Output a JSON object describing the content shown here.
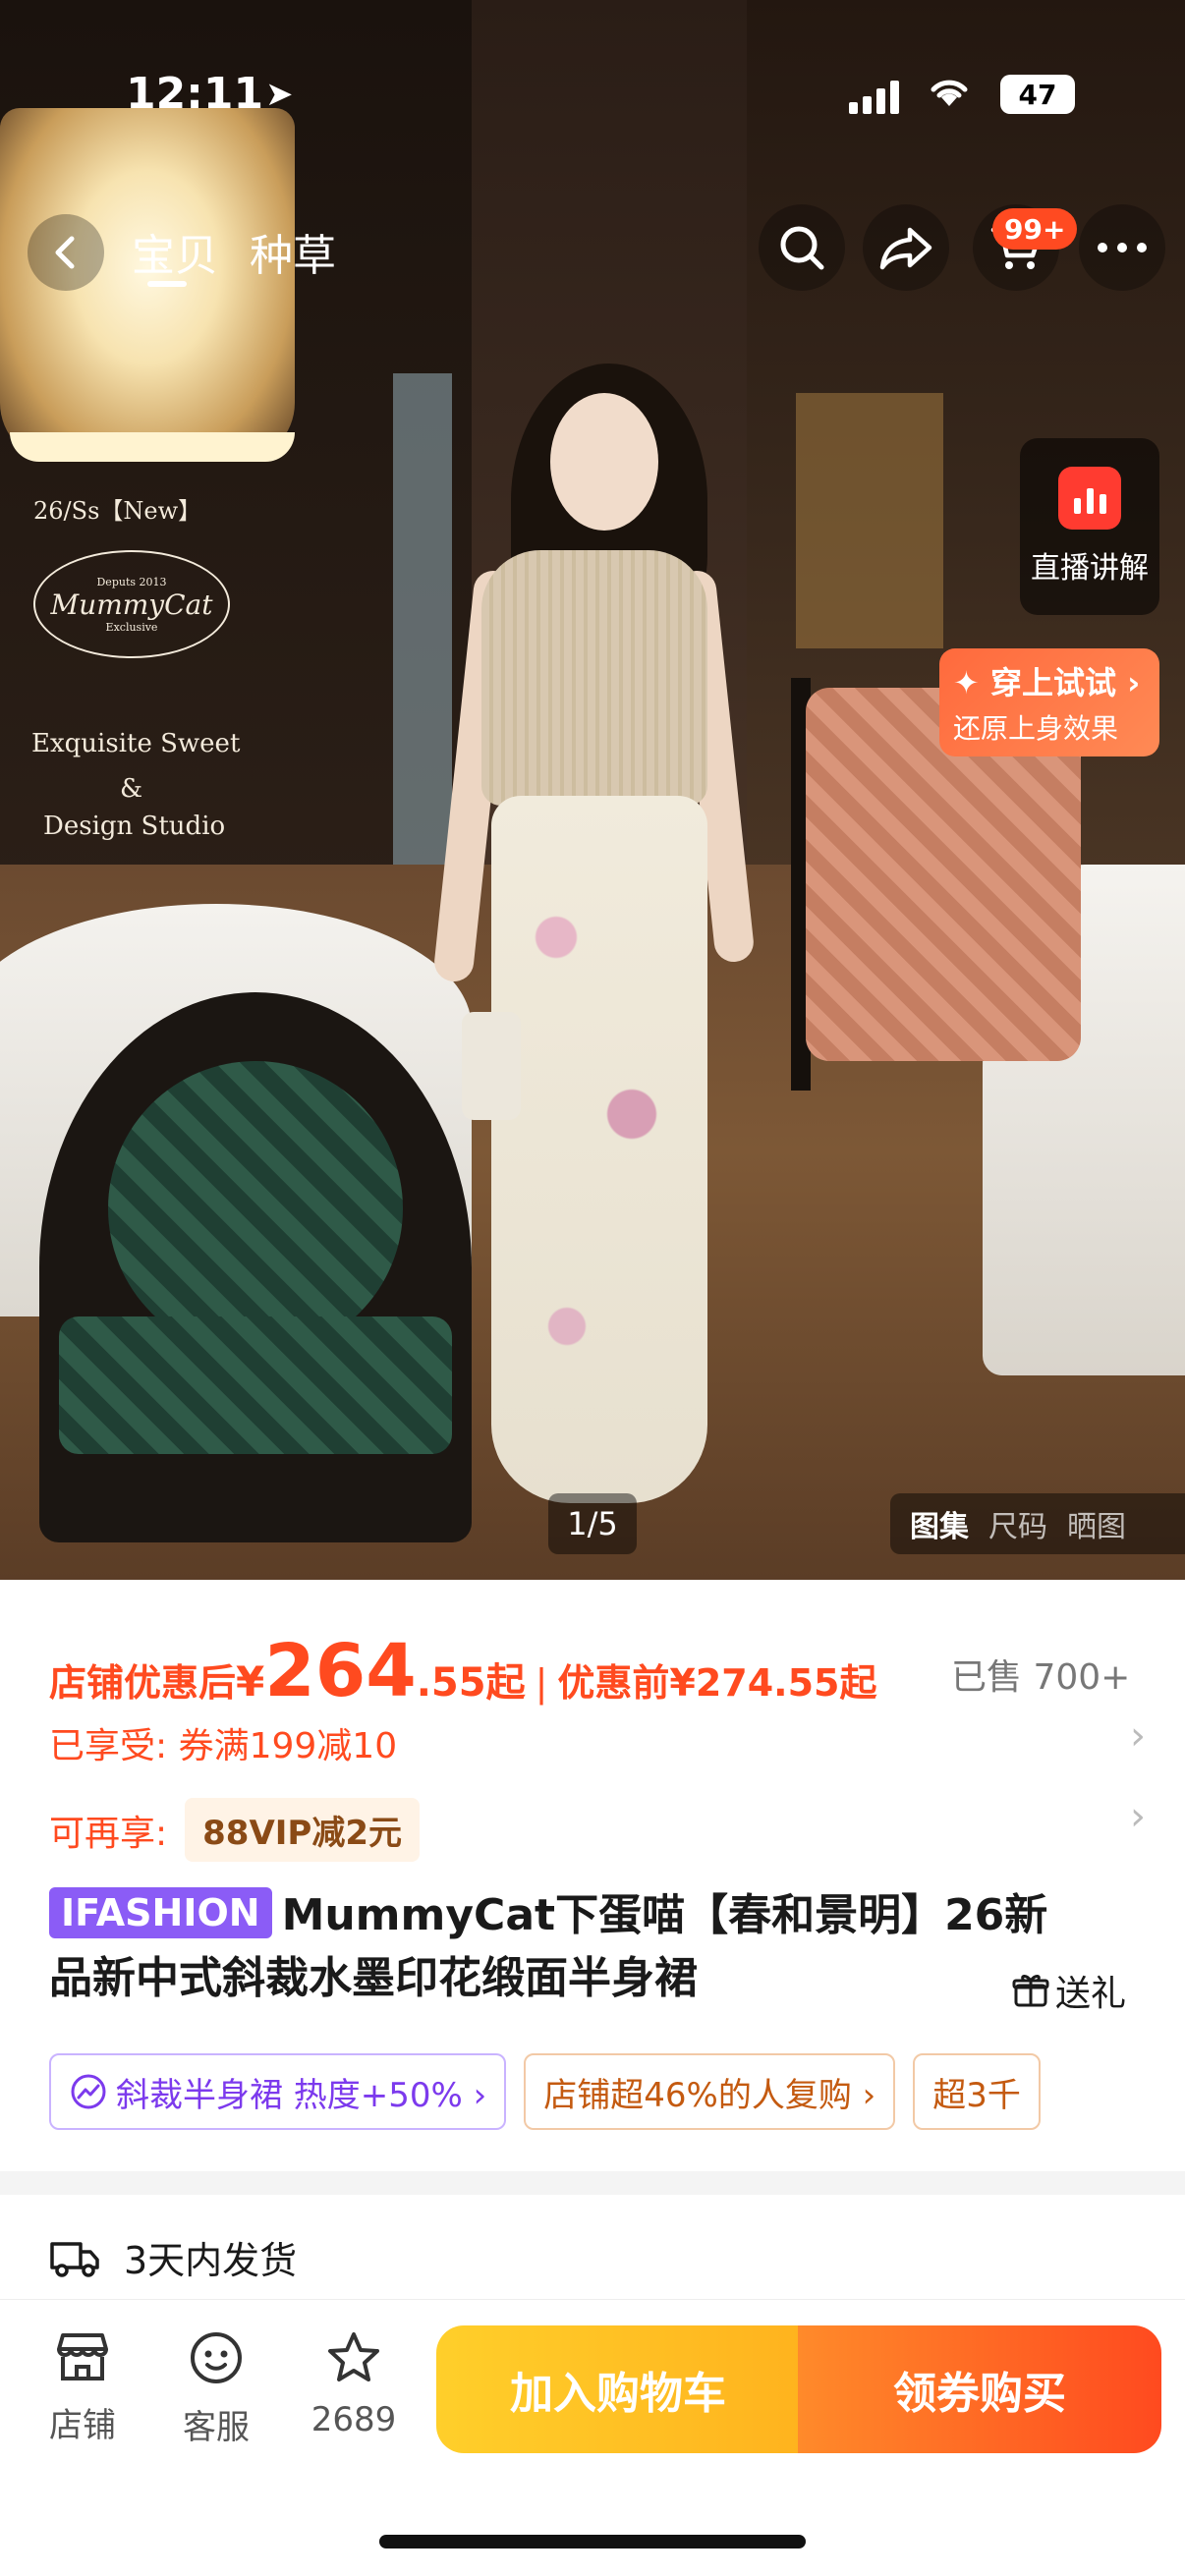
{
  "status_bar": {
    "time": "12:11",
    "battery": "47"
  },
  "nav": {
    "tabs": [
      "宝贝",
      "种草"
    ],
    "cart_badge": "99+"
  },
  "hero": {
    "brand_season": "26/Ss【New】",
    "brand_logo_top": "Deputs 2013",
    "brand_logo_name": "MummyCat",
    "brand_logo_bottom": "Exclusive",
    "brand_tagline_1": "Exquisite Sweet",
    "brand_tagline_amp": "&",
    "brand_tagline_2": "Design Studio",
    "live_label": "直播讲解",
    "tryon_title": "✦ 穿上试试 ›",
    "tryon_sub": "还原上身效果",
    "page_counter": "1/5",
    "gallery_tabs": [
      "图集",
      "尺码",
      "晒图"
    ]
  },
  "price": {
    "label": "店铺优惠后",
    "currency": "¥",
    "integer": "264",
    "decimal": ".55起",
    "prev_label": "优惠前¥274.55起",
    "sold": "已售 700+"
  },
  "promos": {
    "enjoyed": "已享受: 券满199减10",
    "more_label": "可再享:",
    "vip": "88VIP减2元"
  },
  "product": {
    "tag": "IFASHION",
    "title": "MummyCat下蛋喵【春和景明】26新品新中式斜裁水墨印花缎面半身裙",
    "gift": "送礼"
  },
  "chips": [
    {
      "text": "斜裁半身裙 热度+50% ›",
      "style": "purple"
    },
    {
      "text": "店铺超46%的人复购 ›",
      "style": "orange"
    },
    {
      "text": "超3千",
      "style": "orange"
    }
  ],
  "shipping": {
    "text": "3天内发货"
  },
  "bottom_bar": {
    "store": "店铺",
    "service": "客服",
    "favorites": "2689",
    "add_to_cart": "加入购物车",
    "buy": "领券购买"
  },
  "colors": {
    "accent": "#ff4a1f",
    "cart_button": "#ffc21f",
    "buy_button": "#ff5a20",
    "tag_purple": "#8b5cf6"
  },
  "icons": [
    "back-icon",
    "search-icon",
    "share-icon",
    "cart-icon",
    "more-icon",
    "live-icon",
    "gift-icon",
    "truck-icon",
    "store-icon",
    "service-icon",
    "star-icon"
  ]
}
